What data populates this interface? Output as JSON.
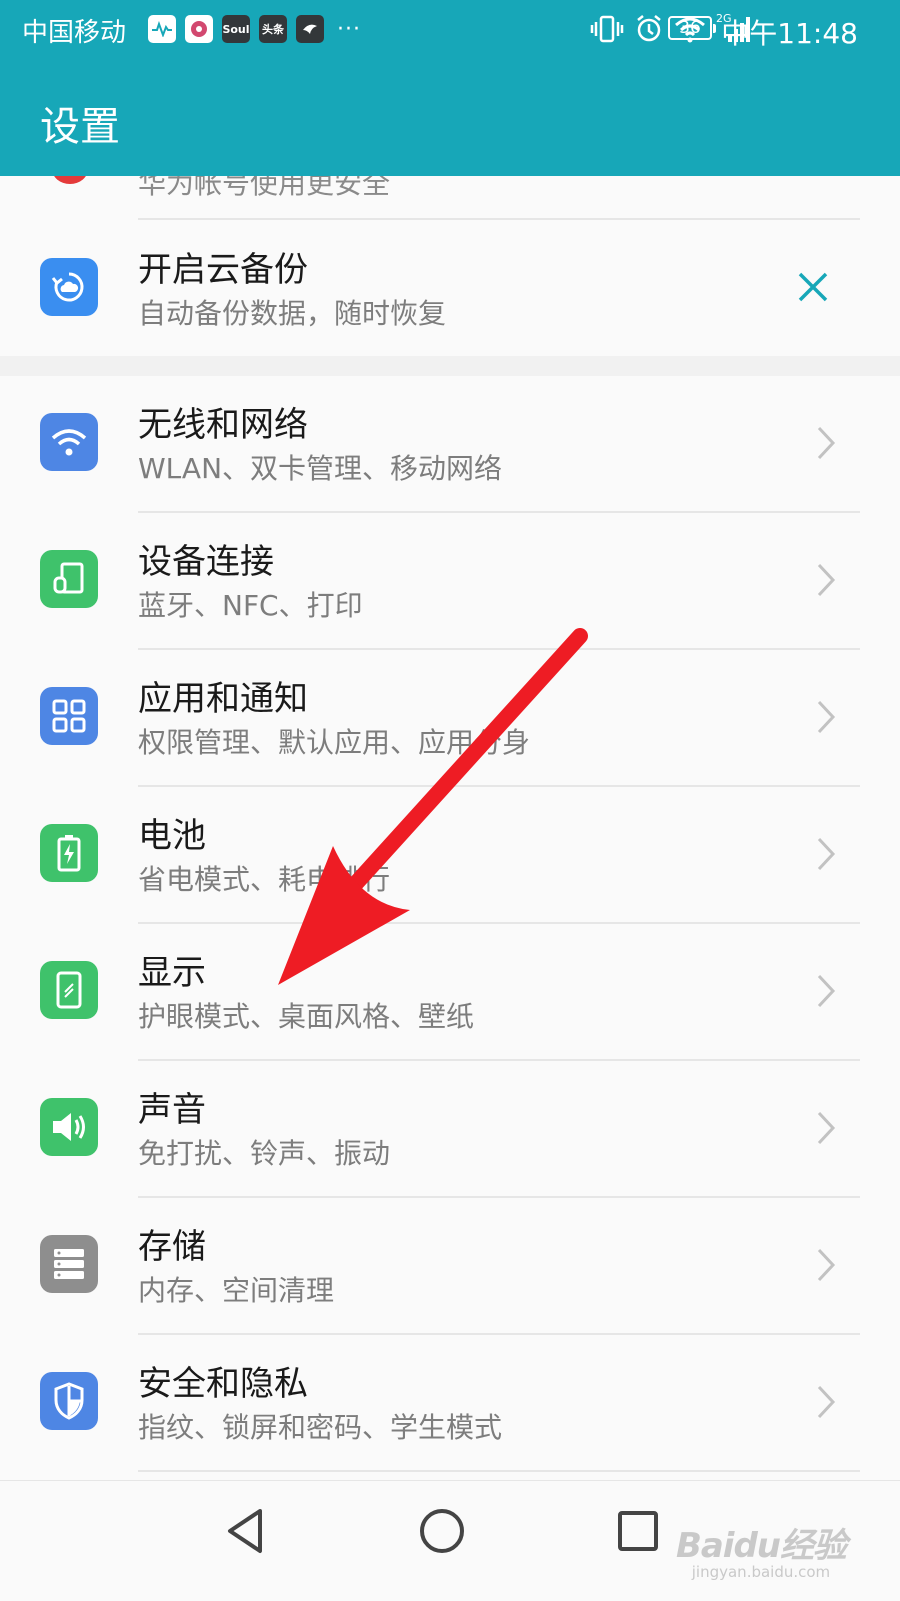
{
  "status_bar": {
    "carrier": "中国移动",
    "app_icons": [
      "health-icon",
      "music-icon",
      "soul-icon",
      "toutiao-icon",
      "bird-icon"
    ],
    "soul_label": "Soul",
    "toutiao_label": "头条",
    "more": "···",
    "network_label": "2G",
    "battery_level": "36",
    "time": "中午11:48"
  },
  "app_bar": {
    "title": "设置"
  },
  "peek_item": {
    "subtitle": "华为帐号使用更安全"
  },
  "backup_card": {
    "title": "开启云备份",
    "subtitle": "自动备份数据，随时恢复"
  },
  "settings_items": [
    {
      "title": "无线和网络",
      "subtitle": "WLAN、双卡管理、移动网络",
      "icon": "wifi-icon",
      "color": "#4e86e4"
    },
    {
      "title": "设备连接",
      "subtitle": "蓝牙、NFC、打印",
      "icon": "device-connect-icon",
      "color": "#3fc26b"
    },
    {
      "title": "应用和通知",
      "subtitle": "权限管理、默认应用、应用分身",
      "icon": "apps-grid-icon",
      "color": "#4e86e4"
    },
    {
      "title": "电池",
      "subtitle": "省电模式、耗电排行",
      "icon": "battery-icon",
      "color": "#3fc26b"
    },
    {
      "title": "显示",
      "subtitle": "护眼模式、桌面风格、壁纸",
      "icon": "display-icon",
      "color": "#3fc26b"
    },
    {
      "title": "声音",
      "subtitle": "免打扰、铃声、振动",
      "icon": "speaker-icon",
      "color": "#3fc26b"
    },
    {
      "title": "存储",
      "subtitle": "内存、空间清理",
      "icon": "storage-icon",
      "color": "#8e8e8e"
    },
    {
      "title": "安全和隐私",
      "subtitle": "指纹、锁屏和密码、学生模式",
      "icon": "shield-icon",
      "color": "#4e86e4"
    }
  ],
  "colors": {
    "app_bar": "#17a7b8",
    "accent": "#17a7b8",
    "arrow": "#ee1c24"
  },
  "watermark": {
    "logo": "Baidu经验",
    "url": "jingyan.baidu.com"
  }
}
